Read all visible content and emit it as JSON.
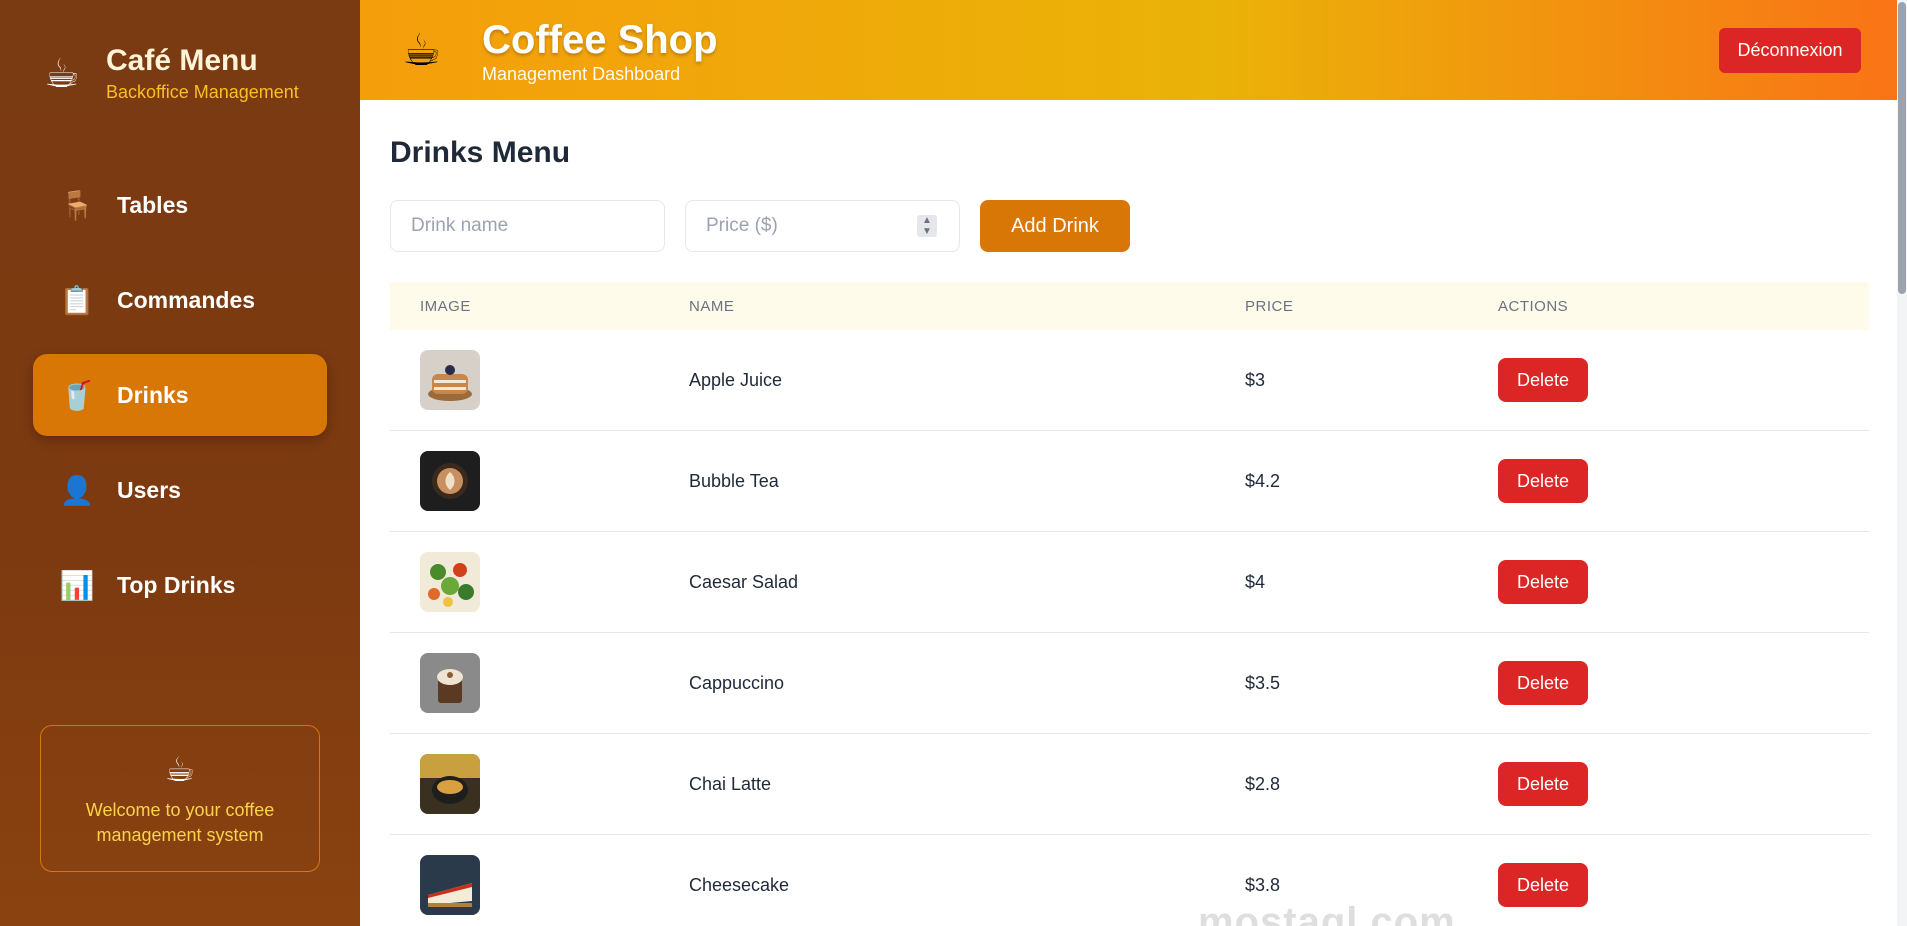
{
  "sidebar": {
    "brand_title": "Café Menu",
    "brand_subtitle": "Backoffice Management",
    "items": [
      {
        "label": "Tables",
        "icon": "🪑",
        "icon_name": "chair-icon"
      },
      {
        "label": "Commandes",
        "icon": "📋",
        "icon_name": "clipboard-icon"
      },
      {
        "label": "Drinks",
        "icon": "🥤",
        "icon_name": "cup-icon",
        "active": true
      },
      {
        "label": "Users",
        "icon": "👤",
        "icon_name": "user-icon"
      },
      {
        "label": "Top Drinks",
        "icon": "📊",
        "icon_name": "bar-chart-icon"
      }
    ],
    "welcome_text": "Welcome to your coffee management system"
  },
  "header": {
    "title": "Coffee Shop",
    "subtitle": "Management Dashboard",
    "logout_label": "Déconnexion"
  },
  "main": {
    "page_title": "Drinks Menu",
    "form": {
      "name_placeholder": "Drink name",
      "price_placeholder": "Price ($)",
      "add_label": "Add Drink"
    },
    "table": {
      "headers": [
        "IMAGE",
        "NAME",
        "PRICE",
        "ACTIONS"
      ],
      "rows": [
        {
          "name": "Apple Juice",
          "price": "$3",
          "action": "Delete",
          "image": "pancakes"
        },
        {
          "name": "Bubble Tea",
          "price": "$4.2",
          "action": "Delete",
          "image": "latte-art"
        },
        {
          "name": "Caesar Salad",
          "price": "$4",
          "action": "Delete",
          "image": "salad"
        },
        {
          "name": "Cappuccino",
          "price": "$3.5",
          "action": "Delete",
          "image": "cappuccino"
        },
        {
          "name": "Chai Latte",
          "price": "$2.8",
          "action": "Delete",
          "image": "chai"
        },
        {
          "name": "Cheesecake",
          "price": "$3.8",
          "action": "Delete",
          "image": "cheesecake"
        }
      ]
    }
  },
  "watermark": "mostaql.com",
  "colors": {
    "sidebar_bg": "#7a3a12",
    "accent": "#d97706",
    "danger": "#dc2626",
    "header_gradient_start": "#f59e0b",
    "header_gradient_end": "#f97316"
  }
}
